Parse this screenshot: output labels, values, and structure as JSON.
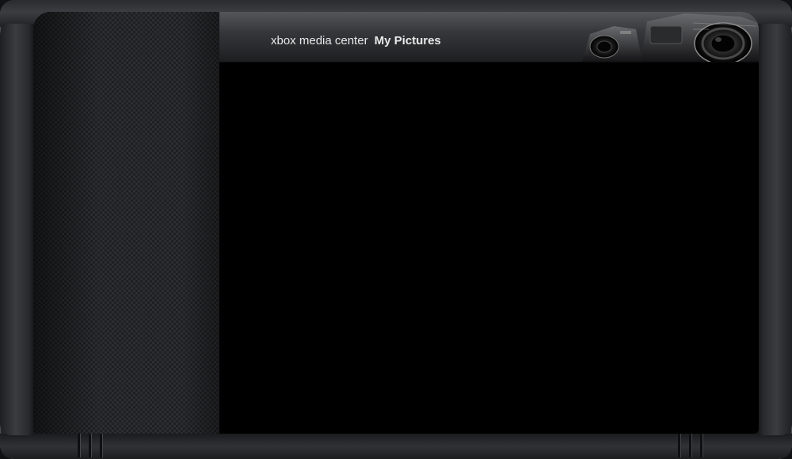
{
  "header": {
    "app_name": "xbox media center",
    "section_title": "My Pictures"
  },
  "decoration": {
    "header_art": "camera-lens-icon"
  },
  "colors": {
    "screen_background": "#000000",
    "frame": "#2a2b2e",
    "header_text": "#e8e8e8"
  }
}
